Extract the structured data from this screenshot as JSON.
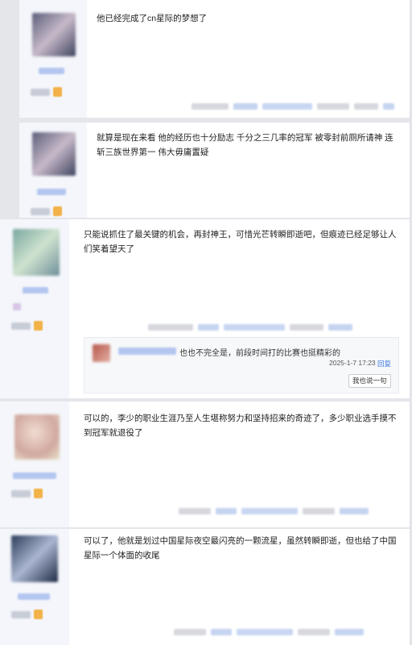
{
  "posts": [
    {
      "content": "他已经完成了cn星际的梦想了"
    },
    {
      "content": "就算是现在来看 他的经历也十分励志 千分之三几率的冠军 被零封前厕所请神 连斩三族世界第一 伟大毋庸置疑"
    },
    {
      "content": "只能说抓住了最关键的机会，再封神王，可惜光芒转瞬即逝吧，但痕迹已经足够让人们笑着望天了",
      "reply": {
        "text": "也也不完全是，前段时间打的比赛也挺精彩的",
        "time": "2025-1-7 17:23",
        "action": "回复",
        "say_button": "我也说一句"
      }
    },
    {
      "content": "可以的，李少的职业生涯乃至人生堪称努力和坚持招来的奇迹了，多少职业选手摸不到冠军就退役了"
    },
    {
      "content": "可以了，他就是划过中国星际夜空最闪亮的一颗流星，虽然转瞬即逝，但也给了中国星际一个体面的收尾"
    }
  ],
  "colors": {
    "accent": "#3f7be0",
    "badge": "#f2b248",
    "background": "#e4e6ea"
  }
}
